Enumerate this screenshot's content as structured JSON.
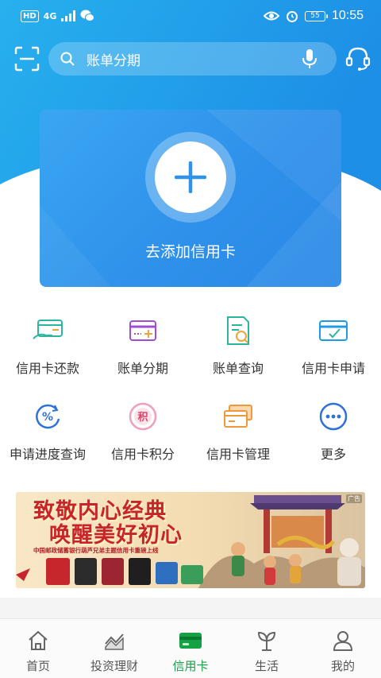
{
  "status_bar": {
    "network_badge": "HD",
    "network_type": "4G",
    "battery": "55",
    "time": "10:55"
  },
  "search": {
    "placeholder_text": "账单分期"
  },
  "add_card": {
    "label": "去添加信用卡"
  },
  "functions": [
    {
      "label": "信用卡还款",
      "icon": "card-repay-icon"
    },
    {
      "label": "账单分期",
      "icon": "bill-installment-icon"
    },
    {
      "label": "账单查询",
      "icon": "bill-query-icon"
    },
    {
      "label": "信用卡申请",
      "icon": "card-apply-icon"
    },
    {
      "label": "申请进度查询",
      "icon": "progress-query-icon"
    },
    {
      "label": "信用卡积分",
      "icon": "card-points-icon"
    },
    {
      "label": "信用卡管理",
      "icon": "card-manage-icon"
    },
    {
      "label": "更多",
      "icon": "more-icon"
    }
  ],
  "banner": {
    "title_line1": "致敬内心经典",
    "title_line2": "唤醒美好初心",
    "subtitle": "中国邮政储蓄银行葫芦兄弟主题信用卡重磅上线",
    "ad_tag": "广告"
  },
  "tab_bar": {
    "active": "信用卡",
    "tabs": [
      {
        "label": "首页",
        "icon": "home-icon"
      },
      {
        "label": "投资理财",
        "icon": "invest-icon"
      },
      {
        "label": "信用卡",
        "icon": "credit-card-icon"
      },
      {
        "label": "生活",
        "icon": "life-icon"
      },
      {
        "label": "我的",
        "icon": "profile-icon"
      }
    ]
  },
  "colors": {
    "header_blue": "#1f9fe8",
    "card_blue": "#3298ec",
    "active_green": "#13a244",
    "banner_red": "#c8242b"
  }
}
